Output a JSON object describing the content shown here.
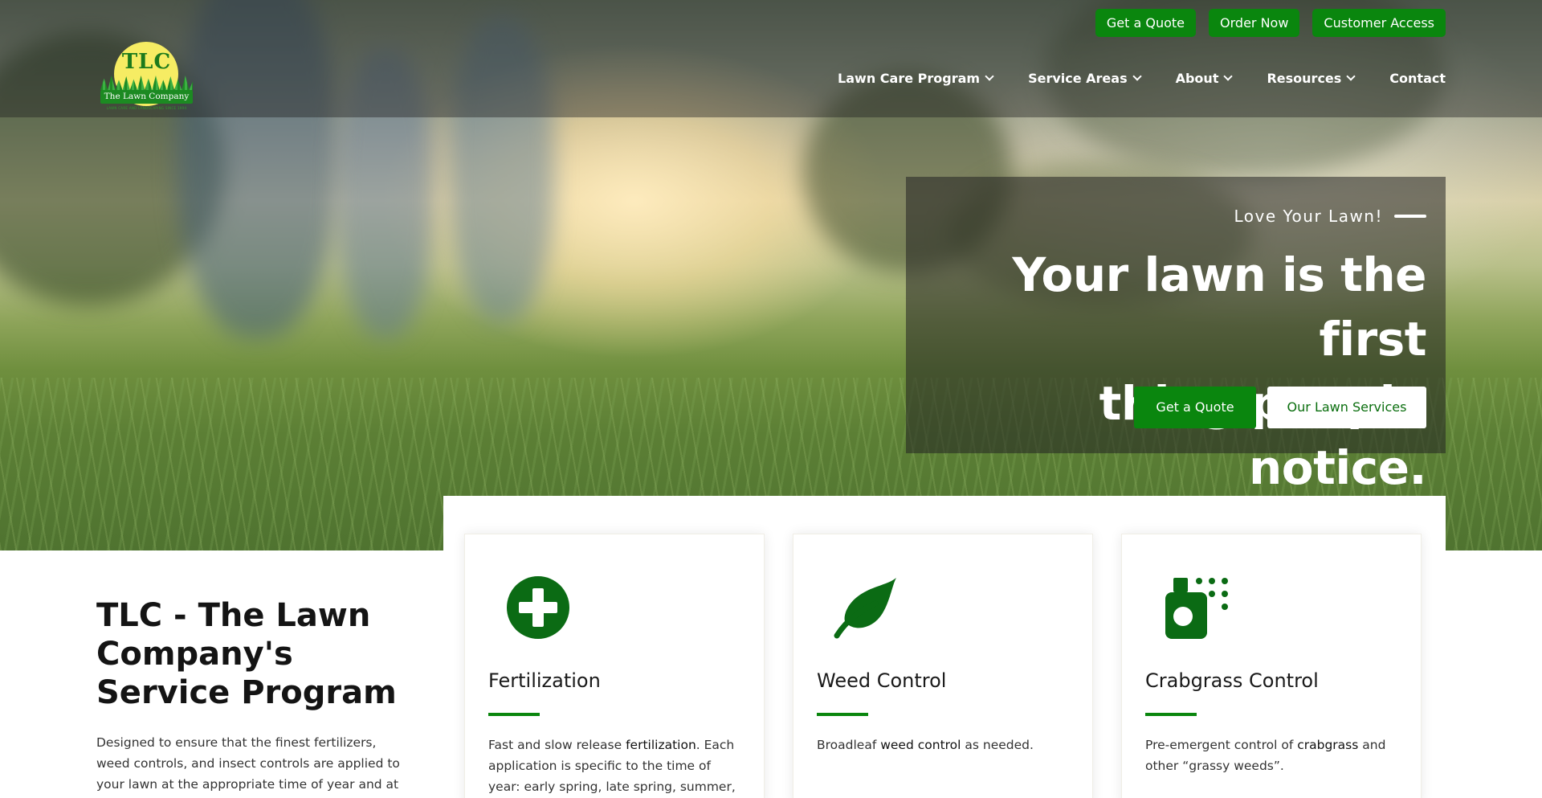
{
  "brand": {
    "logo_initials": "TLC",
    "logo_company": "The Lawn Company",
    "logo_tagline": "LAWN CARE AND LANDSCAPING SINCE 1994",
    "accent_color": "#0a860e",
    "icon_color": "#0b6b14"
  },
  "top_buttons": {
    "get_quote": "Get a Quote",
    "order_now": "Order Now",
    "customer_access": "Customer Access"
  },
  "nav": {
    "items": [
      {
        "label": "Lawn Care Program",
        "has_dropdown": true
      },
      {
        "label": "Service Areas",
        "has_dropdown": true
      },
      {
        "label": "About",
        "has_dropdown": true
      },
      {
        "label": "Resources",
        "has_dropdown": true
      },
      {
        "label": "Contact",
        "has_dropdown": false
      }
    ]
  },
  "hero": {
    "eyebrow": "Love Your Lawn!",
    "headline_line1": "Your lawn is the first",
    "headline_line2": "thing people notice.",
    "primary_button": "Get a Quote",
    "secondary_button": "Our Lawn Services"
  },
  "intro": {
    "title": "TLC - The Lawn Company's Service Program",
    "text": "Designed to ensure that the finest fertilizers, weed controls, and insect controls are applied to your lawn at the appropriate time of year and at the"
  },
  "services": [
    {
      "icon": "plus-circle-icon",
      "title": "Fertilization",
      "text_before": "Fast and slow release ",
      "keyword": "fertilization",
      "text_after": ". Each application is specific to the time of year: early spring, late spring, summer, fall, late"
    },
    {
      "icon": "leaf-icon",
      "title": "Weed Control",
      "text_before": "Broadleaf ",
      "keyword": "weed control",
      "text_after": " as needed."
    },
    {
      "icon": "spray-bottle-icon",
      "title": "Crabgrass Control",
      "text_before": "Pre-emergent control of ",
      "keyword": "crabgrass",
      "text_after": " and other “grassy weeds”."
    }
  ]
}
